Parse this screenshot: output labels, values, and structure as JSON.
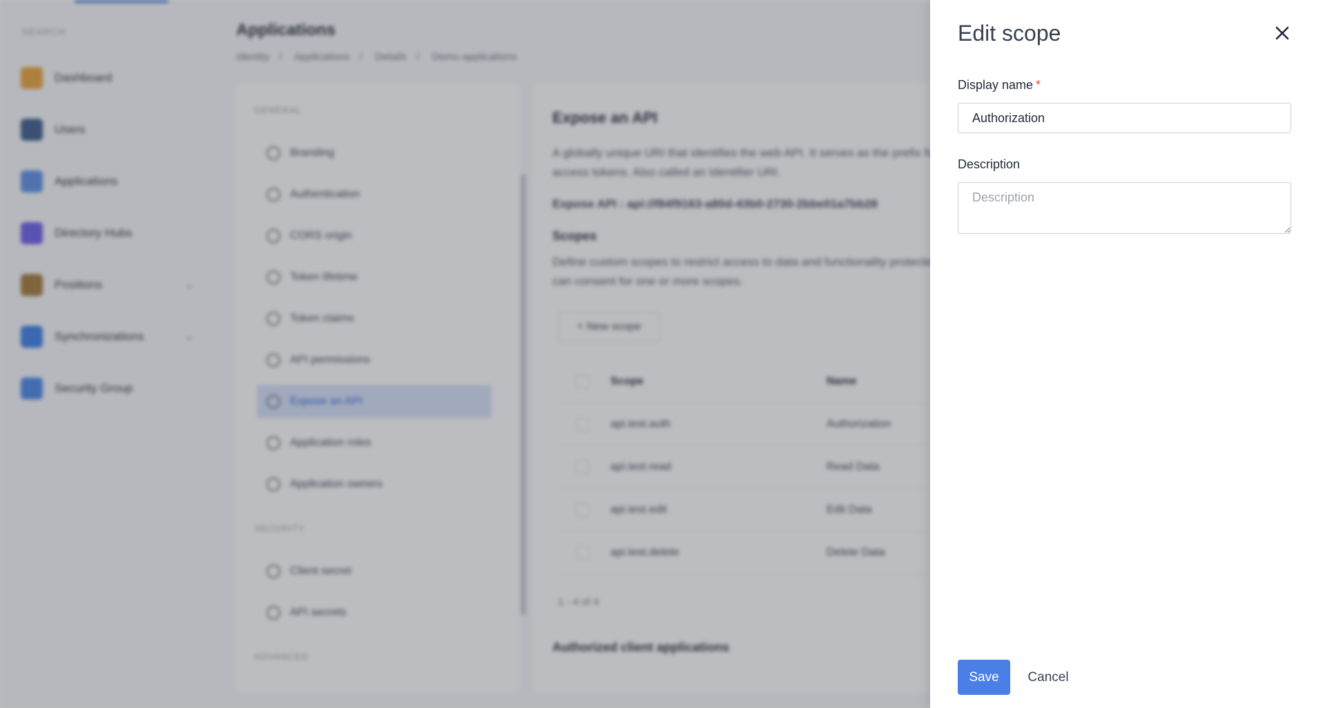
{
  "sidebar": {
    "section_label": "SEARCH",
    "items": [
      {
        "label": "Dashboard",
        "icon": "dashboard-icon",
        "color": "#e8a33a"
      },
      {
        "label": "Users",
        "icon": "user-icon",
        "color": "#3b5b8a"
      },
      {
        "label": "Applications",
        "icon": "applications-icon",
        "color": "#5b8ee6"
      },
      {
        "label": "Directory Hubs",
        "icon": "directory-hub-icon",
        "color": "#6d5ce8"
      },
      {
        "label": "Positions",
        "icon": "positions-icon",
        "color": "#a27a3a"
      },
      {
        "label": "Synchronizations",
        "icon": "sync-icon",
        "color": "#3a7ee8"
      },
      {
        "label": "Security Group",
        "icon": "shield-icon",
        "color": "#4a86e8"
      }
    ]
  },
  "header": {
    "title": "Applications",
    "breadcrumbs": [
      "Identity",
      "Applications",
      "Details",
      "Demo applications"
    ]
  },
  "subnav": {
    "sections": [
      "GENERAL",
      "SECURITY",
      "ADVANCED"
    ],
    "items": [
      "Branding",
      "Authentication",
      "CORS origin",
      "Token lifetime",
      "Token claims",
      "API permissions",
      "Expose an API",
      "Application roles",
      "Application owners"
    ],
    "security_items": [
      "Client secret",
      "API secrets"
    ],
    "active": "Expose an API"
  },
  "content": {
    "title": "Expose an API",
    "intro": "A globally unique URI that identifies the web API. It serves as the prefix for scopes and in access tokens. Also called an Identifier URI.",
    "expose_uri": "Expose API : api://f84f9163-a80d-43b0-2730-2bbe01a7bb28",
    "scopes_heading": "Scopes",
    "scopes_text": "Define custom scopes to restrict access to data and functionality protected by the API. Users can consent for one or more scopes.",
    "new_scope_button": "+ New scope",
    "table": {
      "headers": [
        "Scope",
        "Name"
      ],
      "rows": [
        [
          "api.test.auth",
          "Authorization"
        ],
        [
          "api.test.read",
          "Read Data"
        ],
        [
          "api.test.edit",
          "Edit Data"
        ],
        [
          "api.test.delete",
          "Delete Data"
        ]
      ]
    },
    "pager": "1 - 4 of 4",
    "authorized_heading": "Authorized client applications"
  },
  "drawer": {
    "title": "Edit scope",
    "display_name_label": "Display name",
    "required_marker": "*",
    "display_name_value": "Authorization",
    "description_label": "Description",
    "description_placeholder": "Description",
    "description_value": "",
    "save_label": "Save",
    "cancel_label": "Cancel"
  },
  "colors": {
    "primary": "#4a7fe8",
    "required": "#ef4444",
    "overlay": "rgba(60,63,70,0.34)"
  }
}
